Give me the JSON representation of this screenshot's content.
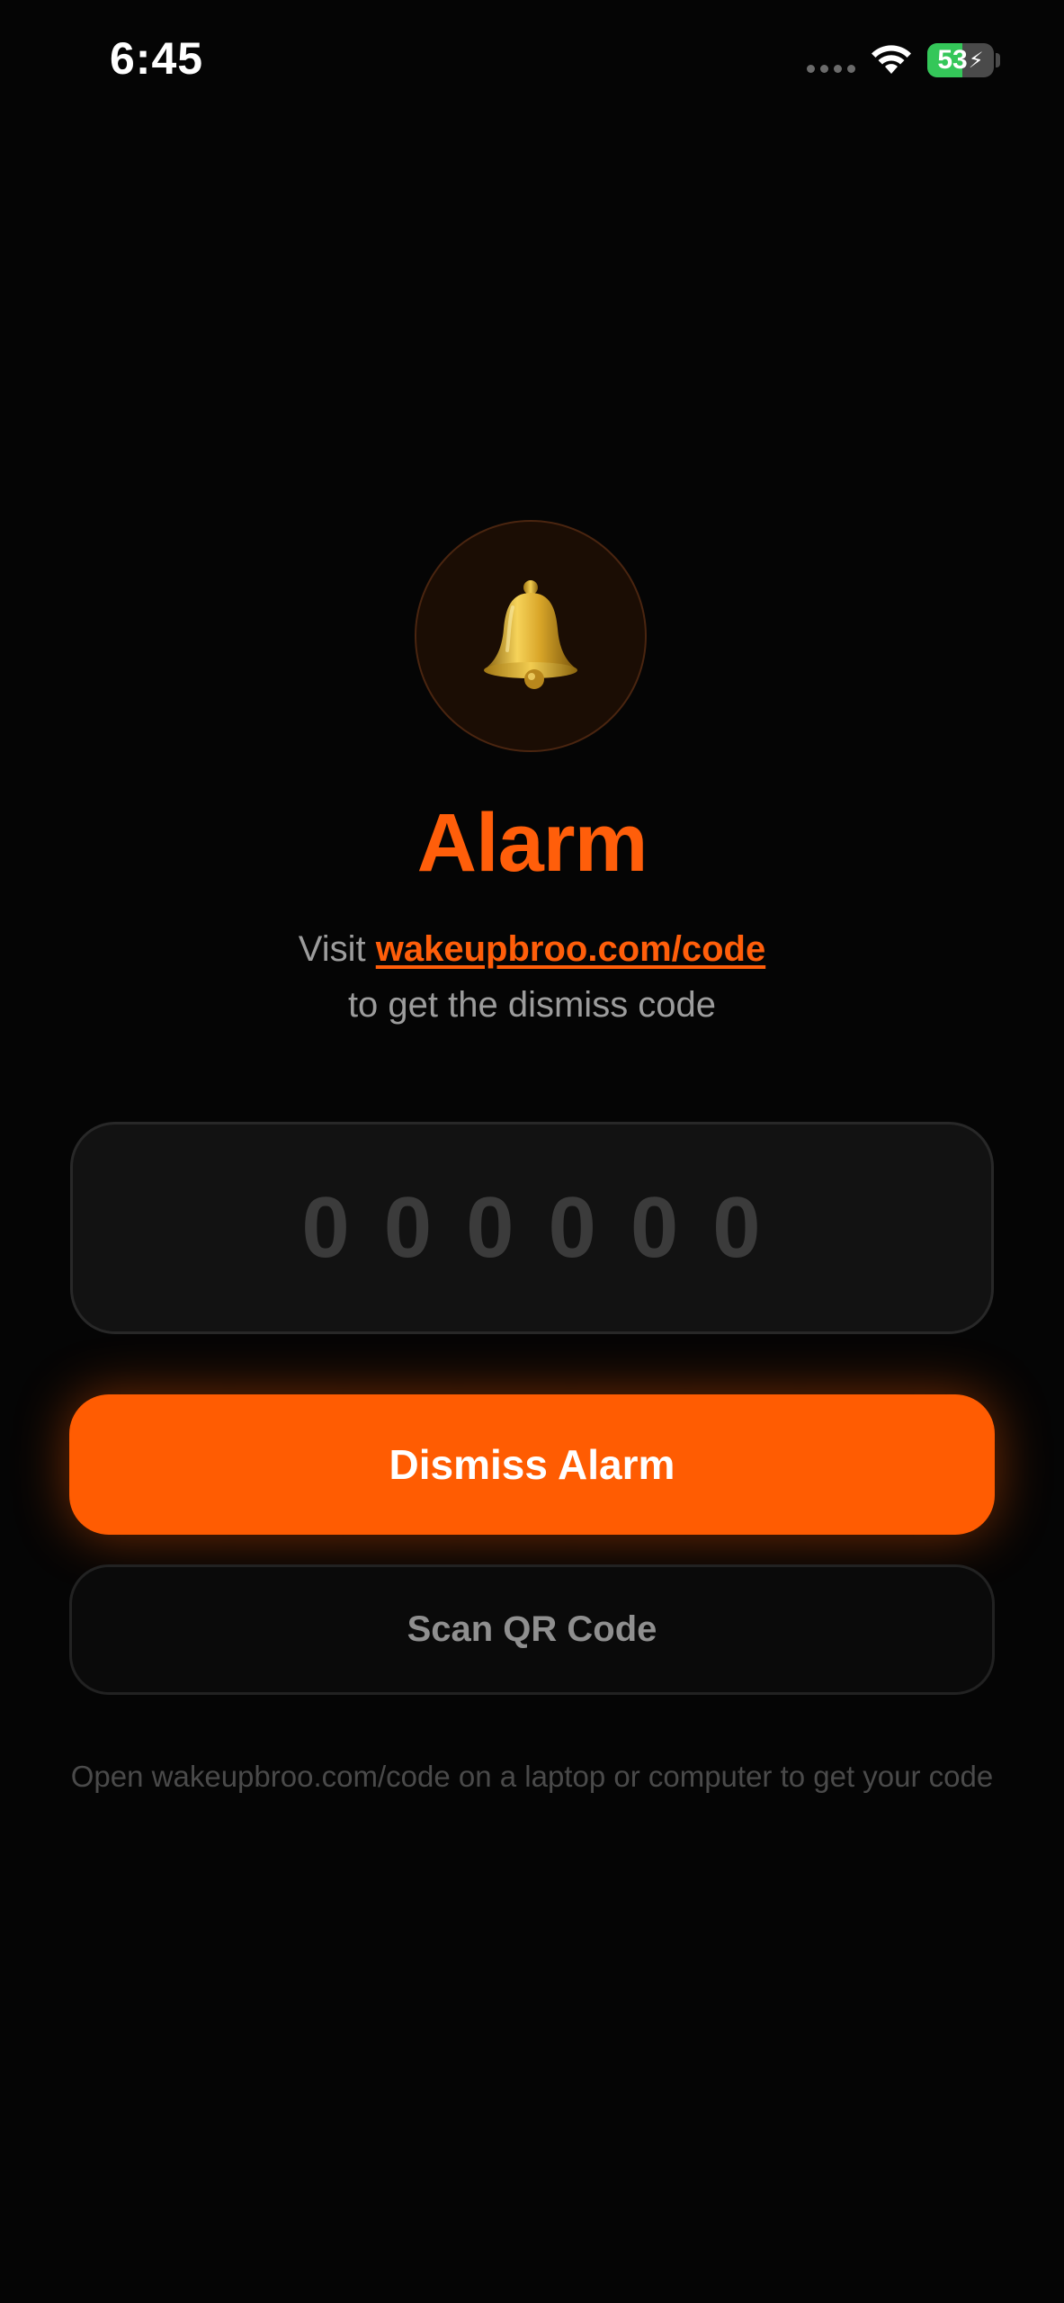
{
  "status_bar": {
    "time": "6:45",
    "battery_percent": "53",
    "battery_level": 0.53,
    "battery_charging": true,
    "icons": [
      "cellular-dots-icon",
      "wifi-icon",
      "battery-icon",
      "charging-bolt-icon"
    ]
  },
  "alarm": {
    "icon": "bell-icon",
    "title": "Alarm",
    "subtitle_prefix": "Visit ",
    "link_text": "wakeupbroo.com/code",
    "subtitle_line2": "to get the dismiss code"
  },
  "code_input": {
    "placeholder": "000000",
    "value": ""
  },
  "buttons": {
    "dismiss_label": "Dismiss Alarm",
    "scan_label": "Scan QR Code"
  },
  "hint": "Open wakeupbroo.com/code on a laptop or computer to get your code",
  "colors": {
    "background": "#050505",
    "accent": "#ff5c02",
    "battery_green": "#34c759",
    "muted_text": "#9c9c9c",
    "hint_text": "#4a4a4a"
  }
}
